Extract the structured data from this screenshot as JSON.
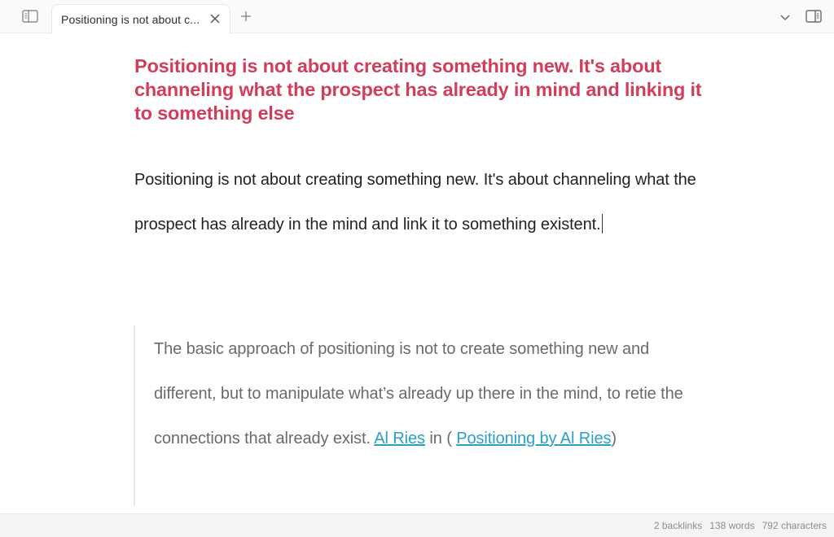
{
  "tabbar": {
    "sidebar_toggle_icon": "left-sidebar-icon",
    "tabs": [
      {
        "label": "Positioning is not about c...",
        "active": true,
        "close_icon": "close-icon"
      }
    ],
    "new_tab_icon": "plus-icon",
    "tab_list_icon": "chevron-down-icon",
    "right_sidebar_icon": "right-sidebar-icon"
  },
  "note": {
    "title": "Positioning is not about creating something new. It's about channeling what the prospect has already in mind and linking it to something else",
    "body": "Positioning is not about creating something new. It's about channeling what the prospect has already in the mind and link it to something existent.",
    "quote": {
      "text": "The basic approach of positioning is not to create something new and different, but to manipulate what’s already up there in the mind, to retie the connections that already exist. ",
      "author_link": "Al Ries",
      "connector": " in (",
      "source_link": "Positioning by Al Ries",
      "closing": ")"
    }
  },
  "statusbar": {
    "backlinks": "2 backlinks",
    "words": "138 words",
    "characters": "792 characters"
  },
  "colors": {
    "title": "#cf3e5b",
    "link": "#2a9fc9",
    "body_text": "#222222",
    "quote_text": "#6a6a6a"
  }
}
